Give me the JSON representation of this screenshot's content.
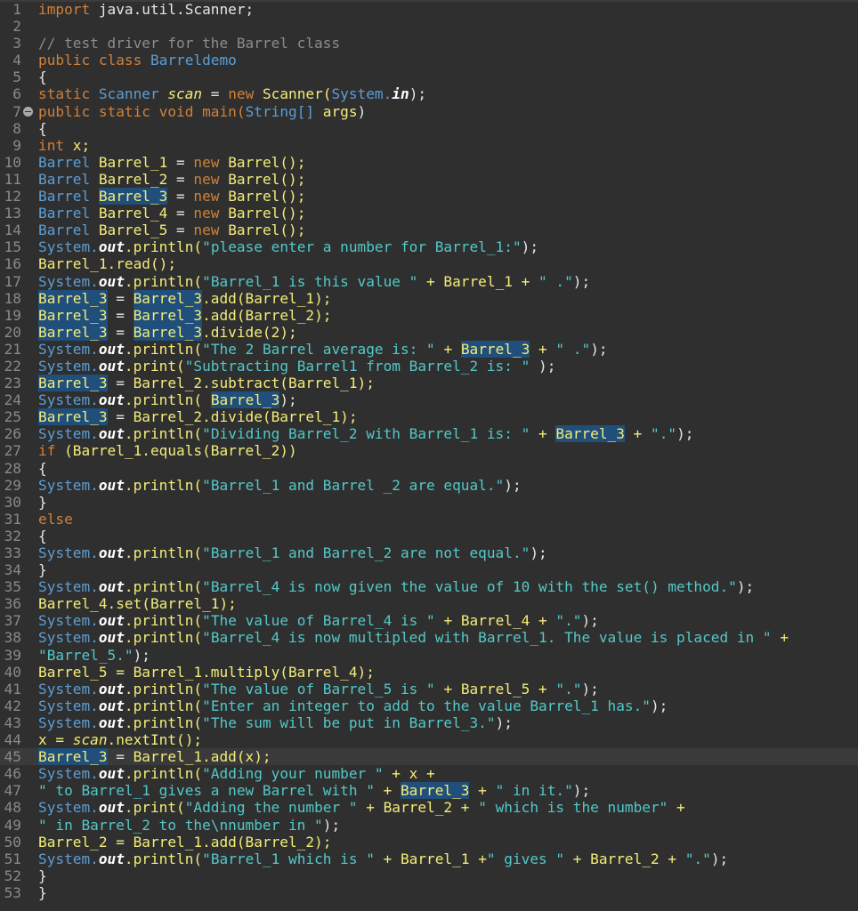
{
  "editor": {
    "language": "java",
    "current_line": 45,
    "marker_line": 7,
    "lines": [
      [
        {
          "t": "import",
          "c": "kw"
        },
        {
          "t": " java.util.Scanner;",
          "c": "ident"
        }
      ],
      [],
      [
        {
          "t": "// test driver for the Barrel class",
          "c": "cmt"
        }
      ],
      [
        {
          "t": "public class ",
          "c": "kw"
        },
        {
          "t": "Barreldemo",
          "c": "type"
        }
      ],
      [
        {
          "t": "{",
          "c": "ident"
        }
      ],
      [
        {
          "t": "static ",
          "c": "kw"
        },
        {
          "t": "Scanner ",
          "c": "type"
        },
        {
          "t": "scan",
          "c": "ital"
        },
        {
          "t": " = ",
          "c": "ident"
        },
        {
          "t": "new ",
          "c": "kw"
        },
        {
          "t": "Scanner(",
          "c": "var"
        },
        {
          "t": "System.",
          "c": "type"
        },
        {
          "t": "in",
          "c": "field"
        },
        {
          "t": ");",
          "c": "ident"
        }
      ],
      [
        {
          "t": "public static void ",
          "c": "kw"
        },
        {
          "t": "main(",
          "c": "kw"
        },
        {
          "t": "String[] ",
          "c": "type"
        },
        {
          "t": "args",
          "c": "var"
        },
        {
          "t": ")",
          "c": "ident"
        }
      ],
      [
        {
          "t": "{",
          "c": "ident"
        }
      ],
      [
        {
          "t": "int ",
          "c": "kw"
        },
        {
          "t": "x;",
          "c": "var"
        }
      ],
      [
        {
          "t": "Barrel ",
          "c": "type"
        },
        {
          "t": "Barrel_1",
          "c": "var"
        },
        {
          "t": " = ",
          "c": "ident"
        },
        {
          "t": "new ",
          "c": "kw"
        },
        {
          "t": "Barrel();",
          "c": "var"
        }
      ],
      [
        {
          "t": "Barrel ",
          "c": "type"
        },
        {
          "t": "Barrel_2",
          "c": "var"
        },
        {
          "t": " = ",
          "c": "ident"
        },
        {
          "t": "new ",
          "c": "kw"
        },
        {
          "t": "Barrel();",
          "c": "var"
        }
      ],
      [
        {
          "t": "Barrel ",
          "c": "type"
        },
        {
          "t": "Barrel_3",
          "c": "var hl"
        },
        {
          "t": " = ",
          "c": "ident"
        },
        {
          "t": "new ",
          "c": "kw"
        },
        {
          "t": "Barrel();",
          "c": "var"
        }
      ],
      [
        {
          "t": "Barrel ",
          "c": "type"
        },
        {
          "t": "Barrel_4",
          "c": "var"
        },
        {
          "t": " = ",
          "c": "ident"
        },
        {
          "t": "new ",
          "c": "kw"
        },
        {
          "t": "Barrel();",
          "c": "var"
        }
      ],
      [
        {
          "t": "Barrel ",
          "c": "type"
        },
        {
          "t": "Barrel_5",
          "c": "var"
        },
        {
          "t": " = ",
          "c": "ident"
        },
        {
          "t": "new ",
          "c": "kw"
        },
        {
          "t": "Barrel();",
          "c": "var"
        }
      ],
      [
        {
          "t": "System.",
          "c": "type"
        },
        {
          "t": "out",
          "c": "field"
        },
        {
          "t": ".println(",
          "c": "var"
        },
        {
          "t": "\"please enter a number for Barrel_1:\"",
          "c": "str"
        },
        {
          "t": ");",
          "c": "ident"
        }
      ],
      [
        {
          "t": "Barrel_1.read();",
          "c": "var"
        }
      ],
      [
        {
          "t": "System.",
          "c": "type"
        },
        {
          "t": "out",
          "c": "field"
        },
        {
          "t": ".println(",
          "c": "var"
        },
        {
          "t": "\"Barrel_1 is this value \"",
          "c": "str"
        },
        {
          "t": " + Barrel_1 + ",
          "c": "var"
        },
        {
          "t": "\" .\"",
          "c": "str"
        },
        {
          "t": ");",
          "c": "ident"
        }
      ],
      [
        {
          "t": "Barrel_3",
          "c": "var hl"
        },
        {
          "t": " = ",
          "c": "ident"
        },
        {
          "t": "Barrel_3",
          "c": "var hl"
        },
        {
          "t": ".add(Barrel_1);",
          "c": "var"
        }
      ],
      [
        {
          "t": "Barrel_3",
          "c": "var hl"
        },
        {
          "t": " = ",
          "c": "ident"
        },
        {
          "t": "Barrel_3",
          "c": "var hl"
        },
        {
          "t": ".add(Barrel_2);",
          "c": "var"
        }
      ],
      [
        {
          "t": "Barrel_3",
          "c": "var hl"
        },
        {
          "t": " = ",
          "c": "ident"
        },
        {
          "t": "Barrel_3",
          "c": "var hl"
        },
        {
          "t": ".divide(2);",
          "c": "var"
        }
      ],
      [
        {
          "t": "System.",
          "c": "type"
        },
        {
          "t": "out",
          "c": "field"
        },
        {
          "t": ".println(",
          "c": "var"
        },
        {
          "t": "\"The 2 Barrel average is: \"",
          "c": "str"
        },
        {
          "t": " + ",
          "c": "var"
        },
        {
          "t": "Barrel_3",
          "c": "var hl"
        },
        {
          "t": " + ",
          "c": "var"
        },
        {
          "t": "\" .\"",
          "c": "str"
        },
        {
          "t": ");",
          "c": "ident"
        }
      ],
      [
        {
          "t": "System.",
          "c": "type"
        },
        {
          "t": "out",
          "c": "field"
        },
        {
          "t": ".print(",
          "c": "var"
        },
        {
          "t": "\"Subtracting Barrel1 from Barrel_2 is: \"",
          "c": "str"
        },
        {
          "t": " );",
          "c": "ident"
        }
      ],
      [
        {
          "t": "Barrel_3",
          "c": "var hl"
        },
        {
          "t": " = ",
          "c": "ident"
        },
        {
          "t": "Barrel_2.subtract(Barrel_1);",
          "c": "var"
        }
      ],
      [
        {
          "t": "System.",
          "c": "type"
        },
        {
          "t": "out",
          "c": "field"
        },
        {
          "t": ".println( ",
          "c": "var"
        },
        {
          "t": "Barrel_3",
          "c": "var hl"
        },
        {
          "t": ");",
          "c": "ident"
        }
      ],
      [
        {
          "t": "Barrel_3",
          "c": "var hl"
        },
        {
          "t": " = ",
          "c": "ident"
        },
        {
          "t": "Barrel_2.divide(Barrel_1);",
          "c": "var"
        }
      ],
      [
        {
          "t": "System.",
          "c": "type"
        },
        {
          "t": "out",
          "c": "field"
        },
        {
          "t": ".println(",
          "c": "var"
        },
        {
          "t": "\"Dividing Barrel_2 with Barrel_1 is: \"",
          "c": "str"
        },
        {
          "t": " + ",
          "c": "var"
        },
        {
          "t": "Barrel_3",
          "c": "var hl"
        },
        {
          "t": " + ",
          "c": "var"
        },
        {
          "t": "\".\"",
          "c": "str"
        },
        {
          "t": ");",
          "c": "ident"
        }
      ],
      [
        {
          "t": "if ",
          "c": "kw"
        },
        {
          "t": "(Barrel_1.equals(Barrel_2))",
          "c": "var"
        }
      ],
      [
        {
          "t": "{",
          "c": "ident"
        }
      ],
      [
        {
          "t": "System.",
          "c": "type"
        },
        {
          "t": "out",
          "c": "field"
        },
        {
          "t": ".println(",
          "c": "var"
        },
        {
          "t": "\"Barrel_1 and Barrel _2 are equal.\"",
          "c": "str"
        },
        {
          "t": ");",
          "c": "ident"
        }
      ],
      [
        {
          "t": "}",
          "c": "ident"
        }
      ],
      [
        {
          "t": "else",
          "c": "kw"
        }
      ],
      [
        {
          "t": "{",
          "c": "ident"
        }
      ],
      [
        {
          "t": "System.",
          "c": "type"
        },
        {
          "t": "out",
          "c": "field"
        },
        {
          "t": ".println(",
          "c": "var"
        },
        {
          "t": "\"Barrel_1 and Barrel_2 are not equal.\"",
          "c": "str"
        },
        {
          "t": ");",
          "c": "ident"
        }
      ],
      [
        {
          "t": "}",
          "c": "ident"
        }
      ],
      [
        {
          "t": "System.",
          "c": "type"
        },
        {
          "t": "out",
          "c": "field"
        },
        {
          "t": ".println(",
          "c": "var"
        },
        {
          "t": "\"Barrel_4 is now given the value of 10 with the set() method.\"",
          "c": "str"
        },
        {
          "t": ");",
          "c": "ident"
        }
      ],
      [
        {
          "t": "Barrel_4.set(Barrel_1);",
          "c": "var"
        }
      ],
      [
        {
          "t": "System.",
          "c": "type"
        },
        {
          "t": "out",
          "c": "field"
        },
        {
          "t": ".println(",
          "c": "var"
        },
        {
          "t": "\"The value of Barrel_4 is \"",
          "c": "str"
        },
        {
          "t": " + Barrel_4 + ",
          "c": "var"
        },
        {
          "t": "\".\"",
          "c": "str"
        },
        {
          "t": ");",
          "c": "ident"
        }
      ],
      [
        {
          "t": "System.",
          "c": "type"
        },
        {
          "t": "out",
          "c": "field"
        },
        {
          "t": ".println(",
          "c": "var"
        },
        {
          "t": "\"Barrel_4 is now multipled with Barrel_1. The value is placed in \"",
          "c": "str"
        },
        {
          "t": " +",
          "c": "var"
        }
      ],
      [
        {
          "t": "\"Barrel_5.\"",
          "c": "str"
        },
        {
          "t": ");",
          "c": "ident"
        }
      ],
      [
        {
          "t": "Barrel_5 = Barrel_1.multiply(Barrel_4);",
          "c": "var"
        }
      ],
      [
        {
          "t": "System.",
          "c": "type"
        },
        {
          "t": "out",
          "c": "field"
        },
        {
          "t": ".println(",
          "c": "var"
        },
        {
          "t": "\"The value of Barrel_5 is \"",
          "c": "str"
        },
        {
          "t": " + Barrel_5 + ",
          "c": "var"
        },
        {
          "t": "\".\"",
          "c": "str"
        },
        {
          "t": ");",
          "c": "ident"
        }
      ],
      [
        {
          "t": "System.",
          "c": "type"
        },
        {
          "t": "out",
          "c": "field"
        },
        {
          "t": ".println(",
          "c": "var"
        },
        {
          "t": "\"Enter an integer to add to the value Barrel_1 has.\"",
          "c": "str"
        },
        {
          "t": ");",
          "c": "ident"
        }
      ],
      [
        {
          "t": "System.",
          "c": "type"
        },
        {
          "t": "out",
          "c": "field"
        },
        {
          "t": ".println(",
          "c": "var"
        },
        {
          "t": "\"The sum will be put in Barrel_3.\"",
          "c": "str"
        },
        {
          "t": ");",
          "c": "ident"
        }
      ],
      [
        {
          "t": "x = ",
          "c": "var"
        },
        {
          "t": "scan",
          "c": "ital"
        },
        {
          "t": ".nextInt();",
          "c": "var"
        }
      ],
      [
        {
          "t": "Barrel_3",
          "c": "var hl"
        },
        {
          "t": " = ",
          "c": "ident"
        },
        {
          "t": "Barrel_1.add(x);",
          "c": "var"
        }
      ],
      [
        {
          "t": "System.",
          "c": "type"
        },
        {
          "t": "out",
          "c": "field"
        },
        {
          "t": ".println(",
          "c": "var"
        },
        {
          "t": "\"Adding your number \"",
          "c": "str"
        },
        {
          "t": " + x +",
          "c": "var"
        }
      ],
      [
        {
          "t": "\" to Barrel_1 gives a new Barrel with \"",
          "c": "str"
        },
        {
          "t": " + ",
          "c": "var"
        },
        {
          "t": "Barrel_3",
          "c": "var hl"
        },
        {
          "t": " + ",
          "c": "var"
        },
        {
          "t": "\" in it.\"",
          "c": "str"
        },
        {
          "t": ");",
          "c": "ident"
        }
      ],
      [
        {
          "t": "System.",
          "c": "type"
        },
        {
          "t": "out",
          "c": "field"
        },
        {
          "t": ".print(",
          "c": "var"
        },
        {
          "t": "\"Adding the number \"",
          "c": "str"
        },
        {
          "t": " + Barrel_2 + ",
          "c": "var"
        },
        {
          "t": "\" which is the number\"",
          "c": "str"
        },
        {
          "t": " +",
          "c": "var"
        }
      ],
      [
        {
          "t": "\" in Barrel_2 to the\\nnumber in \"",
          "c": "str"
        },
        {
          "t": ");",
          "c": "ident"
        }
      ],
      [
        {
          "t": "Barrel_2 = Barrel_1.add(Barrel_2);",
          "c": "var"
        }
      ],
      [
        {
          "t": "System.",
          "c": "type"
        },
        {
          "t": "out",
          "c": "field"
        },
        {
          "t": ".println(",
          "c": "var"
        },
        {
          "t": "\"Barrel_1 which is \"",
          "c": "str"
        },
        {
          "t": " + Barrel_1 +",
          "c": "var"
        },
        {
          "t": "\" gives \"",
          "c": "str"
        },
        {
          "t": " + Barrel_2 + ",
          "c": "var"
        },
        {
          "t": "\".\"",
          "c": "str"
        },
        {
          "t": ");",
          "c": "ident"
        }
      ],
      [
        {
          "t": "}",
          "c": "ident"
        }
      ],
      [
        {
          "t": "}",
          "c": "ident"
        }
      ]
    ]
  },
  "colors": {
    "background": "#2f2f2f",
    "keyword": "#d1803a",
    "type": "#5b9ed6",
    "variable": "#f3ec79",
    "string": "#53c8c8",
    "comment": "#8c8c8c",
    "highlight": "#1f4f7a",
    "line_number": "#8a8a8a"
  },
  "icons": {
    "fold_marker": "collapse-icon"
  }
}
